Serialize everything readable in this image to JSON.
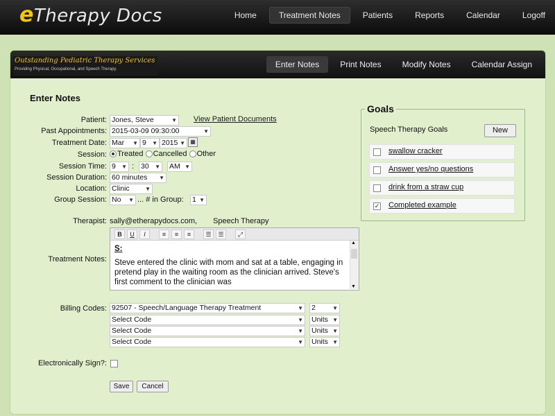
{
  "app": {
    "brand_mark": "e",
    "brand_name": "Therapy Docs"
  },
  "top_nav": [
    "Home",
    "Treatment Notes",
    "Patients",
    "Reports",
    "Calendar",
    "Logoff"
  ],
  "top_nav_active": "Treatment Notes",
  "logo": {
    "line1": "Outstanding Pediatric Therapy Services",
    "line2": "Providing Physical, Occupational, and Speech Therapy."
  },
  "sub_nav": [
    "Enter Notes",
    "Print Notes",
    "Modify Notes",
    "Calendar Assign"
  ],
  "sub_nav_active": "Enter Notes",
  "form": {
    "heading": "Enter Notes",
    "patient_label": "Patient:",
    "patient_value": "Jones, Steve",
    "view_docs": "View Patient Documents",
    "past_appt_label": "Past Appointments:",
    "past_appt_value": "2015-03-09 09:30:00",
    "treat_date_label": "Treatment Date:",
    "treat_month": "Mar",
    "treat_day": "9",
    "treat_year": "2015",
    "session_label": "Session:",
    "session_options": [
      "Treated",
      "Cancelled",
      "Other"
    ],
    "session_selected": "Treated",
    "session_time_label": "Session Time:",
    "time_hour": "9",
    "time_sep": ":",
    "time_min": "30",
    "time_ampm": "AM",
    "duration_label": "Session Duration:",
    "duration_value": "60 minutes",
    "location_label": "Location:",
    "location_value": "Clinic",
    "group_label": "Group Session:",
    "group_value": "No",
    "in_group_label": "... # in Group:",
    "in_group_value": "1",
    "therapist_label": "Therapist:",
    "therapist_value": "sally@etherapydocs.com,",
    "therapist_discipline": "Speech Therapy",
    "notes_label": "Treatment Notes:",
    "editor_tools": [
      "B",
      "U",
      "I",
      "≡",
      "≡",
      "≡",
      "☰",
      "☰",
      "⤢"
    ],
    "notes_heading": "S:",
    "notes_text": "Steve entered the clinic with mom and sat at a table, engaging in pretend play in the waiting room as the clinician arrived. Steve's first comment to the clinician was",
    "billing_label": "Billing Codes:",
    "billing_rows": [
      {
        "code": "92507 - Speech/Language Therapy Treatment",
        "units": "2"
      },
      {
        "code": "Select Code",
        "units": "Units"
      },
      {
        "code": "Select Code",
        "units": "Units"
      },
      {
        "code": "Select Code",
        "units": "Units"
      }
    ],
    "sign_label": "Electronically Sign?:",
    "save": "Save",
    "cancel": "Cancel"
  },
  "goals": {
    "legend": "Goals",
    "section_title": "Speech Therapy Goals",
    "new_button": "New",
    "items": [
      {
        "label": "swallow cracker",
        "checked": false
      },
      {
        "label": "Answer yes/no questions",
        "checked": false
      },
      {
        "label": "drink from a straw cup",
        "checked": false
      },
      {
        "label": "Completed example",
        "checked": true
      }
    ]
  }
}
